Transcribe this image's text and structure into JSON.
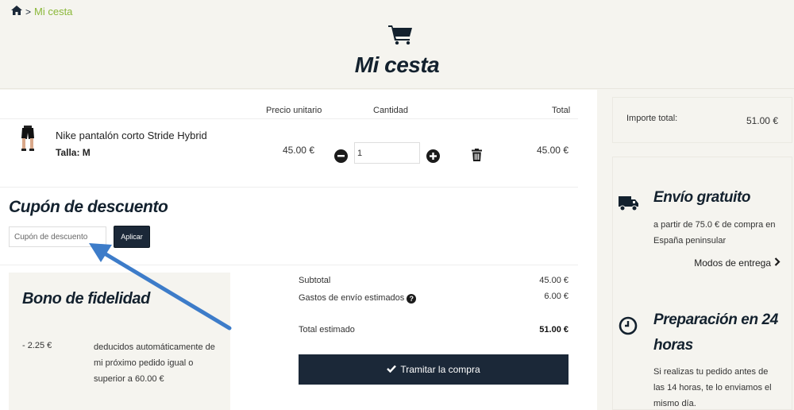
{
  "breadcrumb": {
    "home_icon": "home-icon",
    "separator": ">",
    "current": "Mi cesta"
  },
  "header": {
    "icon": "shopping-cart-icon",
    "title": "Mi cesta"
  },
  "cart_table": {
    "headers": {
      "unit_price": "Precio unitario",
      "quantity": "Cantidad",
      "total": "Total"
    },
    "items": [
      {
        "name": "Nike pantalón corto Stride Hybrid",
        "size_label": "Talla: M",
        "unit_price": "45.00 €",
        "quantity": "1",
        "total": "45.00 €"
      }
    ]
  },
  "coupon": {
    "title": "Cupón de descuento",
    "placeholder": "Cupón de descuento",
    "apply_label": "Aplicar"
  },
  "loyalty": {
    "title": "Bono de fidelidad",
    "amount": "- 2.25 €",
    "description": "deducidos automáticamente de mi próximo pedido igual o superior a 60.00 €"
  },
  "summary": {
    "subtotal_label": "Subtotal",
    "subtotal_value": "45.00 €",
    "shipping_label": "Gastos de envío estimados",
    "shipping_value": "6.00 €",
    "total_label": "Total estimado",
    "total_value": "51.00 €",
    "checkout_label": "Tramitar la compra"
  },
  "sidebar": {
    "total_label": "Importe total:",
    "total_value": "51.00 €",
    "shipping_title": "Envío gratuito",
    "shipping_text": "a partir de 75.0 € de compra en España peninsular",
    "delivery_link": "Modos de entrega",
    "prep_title": "Preparación en 24 horas",
    "prep_text": "Si realizas tu pedido antes de las 14 horas, te lo enviamos el mismo día."
  },
  "colors": {
    "accent_green": "#8bb83a",
    "navy": "#1b2838",
    "annotation_arrow": "#3d7cc9"
  }
}
